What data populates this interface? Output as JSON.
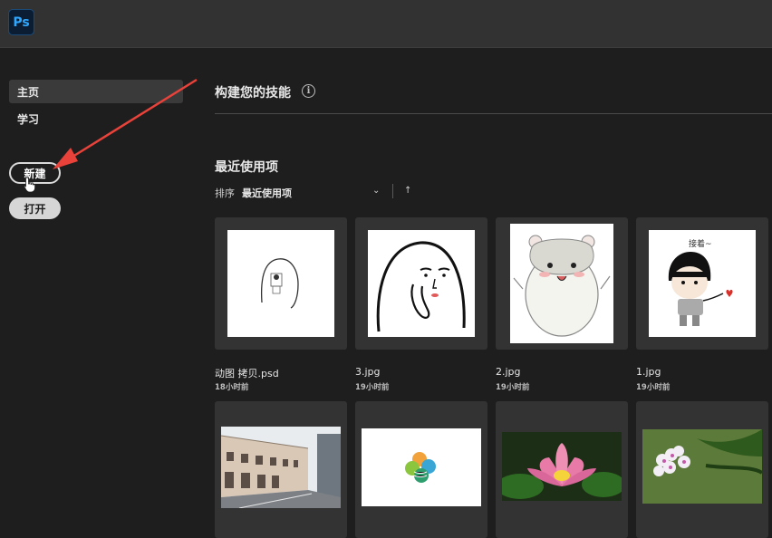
{
  "app": {
    "logo_text": "Ps"
  },
  "sidebar": {
    "items": [
      {
        "label": "主页",
        "active": true
      },
      {
        "label": "学习",
        "active": false
      }
    ],
    "new_button": "新建",
    "open_button": "打开"
  },
  "main": {
    "skills_title": "构建您的技能",
    "recent_title": "最近使用项",
    "sort_label": "排序",
    "sort_value": "最近使用项"
  },
  "files": [
    {
      "name": "动图 拷贝.psd",
      "time": "18小时前"
    },
    {
      "name": "3.jpg",
      "time": "19小时前"
    },
    {
      "name": "2.jpg",
      "time": "19小时前"
    },
    {
      "name": "1.jpg",
      "time": "19小时前"
    }
  ],
  "thumb_text": {
    "greeting": "接着~"
  },
  "colors": {
    "accent_ps": "#31a8ff",
    "arrow": "#e8423a",
    "background": "#1e1e1e"
  }
}
